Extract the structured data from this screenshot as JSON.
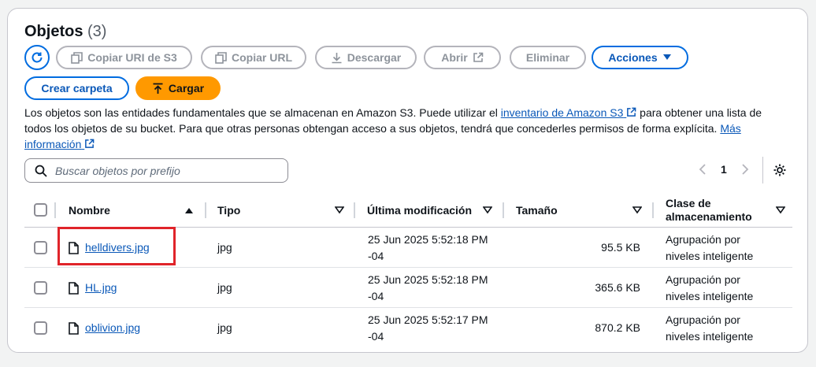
{
  "header": {
    "title": "Objetos",
    "count": "(3)"
  },
  "toolbar": {
    "refresh_icon": "refresh-icon",
    "copy_uri_label": "Copiar URI de S3",
    "copy_url_label": "Copiar URL",
    "download_label": "Descargar",
    "open_label": "Abrir",
    "delete_label": "Eliminar",
    "actions_label": "Acciones",
    "create_folder_label": "Crear carpeta",
    "upload_label": "Cargar"
  },
  "description": {
    "part1": "Los objetos son las entidades fundamentales que se almacenan en Amazon S3. Puede utilizar el ",
    "link1": "inventario de Amazon S3",
    "part2": " para obtener una lista de todos los objetos de su bucket. Para que otras personas obtengan acceso a sus objetos, tendrá que concederles permisos de forma explícita. ",
    "link2": "Más información"
  },
  "search": {
    "placeholder": "Buscar objetos por prefijo"
  },
  "pagination": {
    "current_page": "1"
  },
  "table": {
    "headers": {
      "name": "Nombre",
      "type": "Tipo",
      "modified": "Última modificación",
      "size": "Tamaño",
      "storage_class_line1": "Clase de",
      "storage_class_line2": "almacenamiento"
    },
    "rows": [
      {
        "name": "helldivers.jpg",
        "type": "jpg",
        "modified_line1": "25 Jun 2025 5:52:18 PM",
        "modified_line2": "-04",
        "size": "95.5 KB",
        "class_line1": "Agrupación por",
        "class_line2": "niveles inteligente"
      },
      {
        "name": "HL.jpg",
        "type": "jpg",
        "modified_line1": "25 Jun 2025 5:52:18 PM",
        "modified_line2": "-04",
        "size": "365.6 KB",
        "class_line1": "Agrupación por",
        "class_line2": "niveles inteligente"
      },
      {
        "name": "oblivion.jpg",
        "type": "jpg",
        "modified_line1": "25 Jun 2025 5:52:17 PM",
        "modified_line2": "-04",
        "size": "870.2 KB",
        "class_line1": "Agrupación por",
        "class_line2": "niveles inteligente"
      }
    ]
  },
  "colors": {
    "accent": "#006ce0",
    "link": "#0a58b8",
    "orange": "#ff9900",
    "highlight": "#e0242a"
  }
}
